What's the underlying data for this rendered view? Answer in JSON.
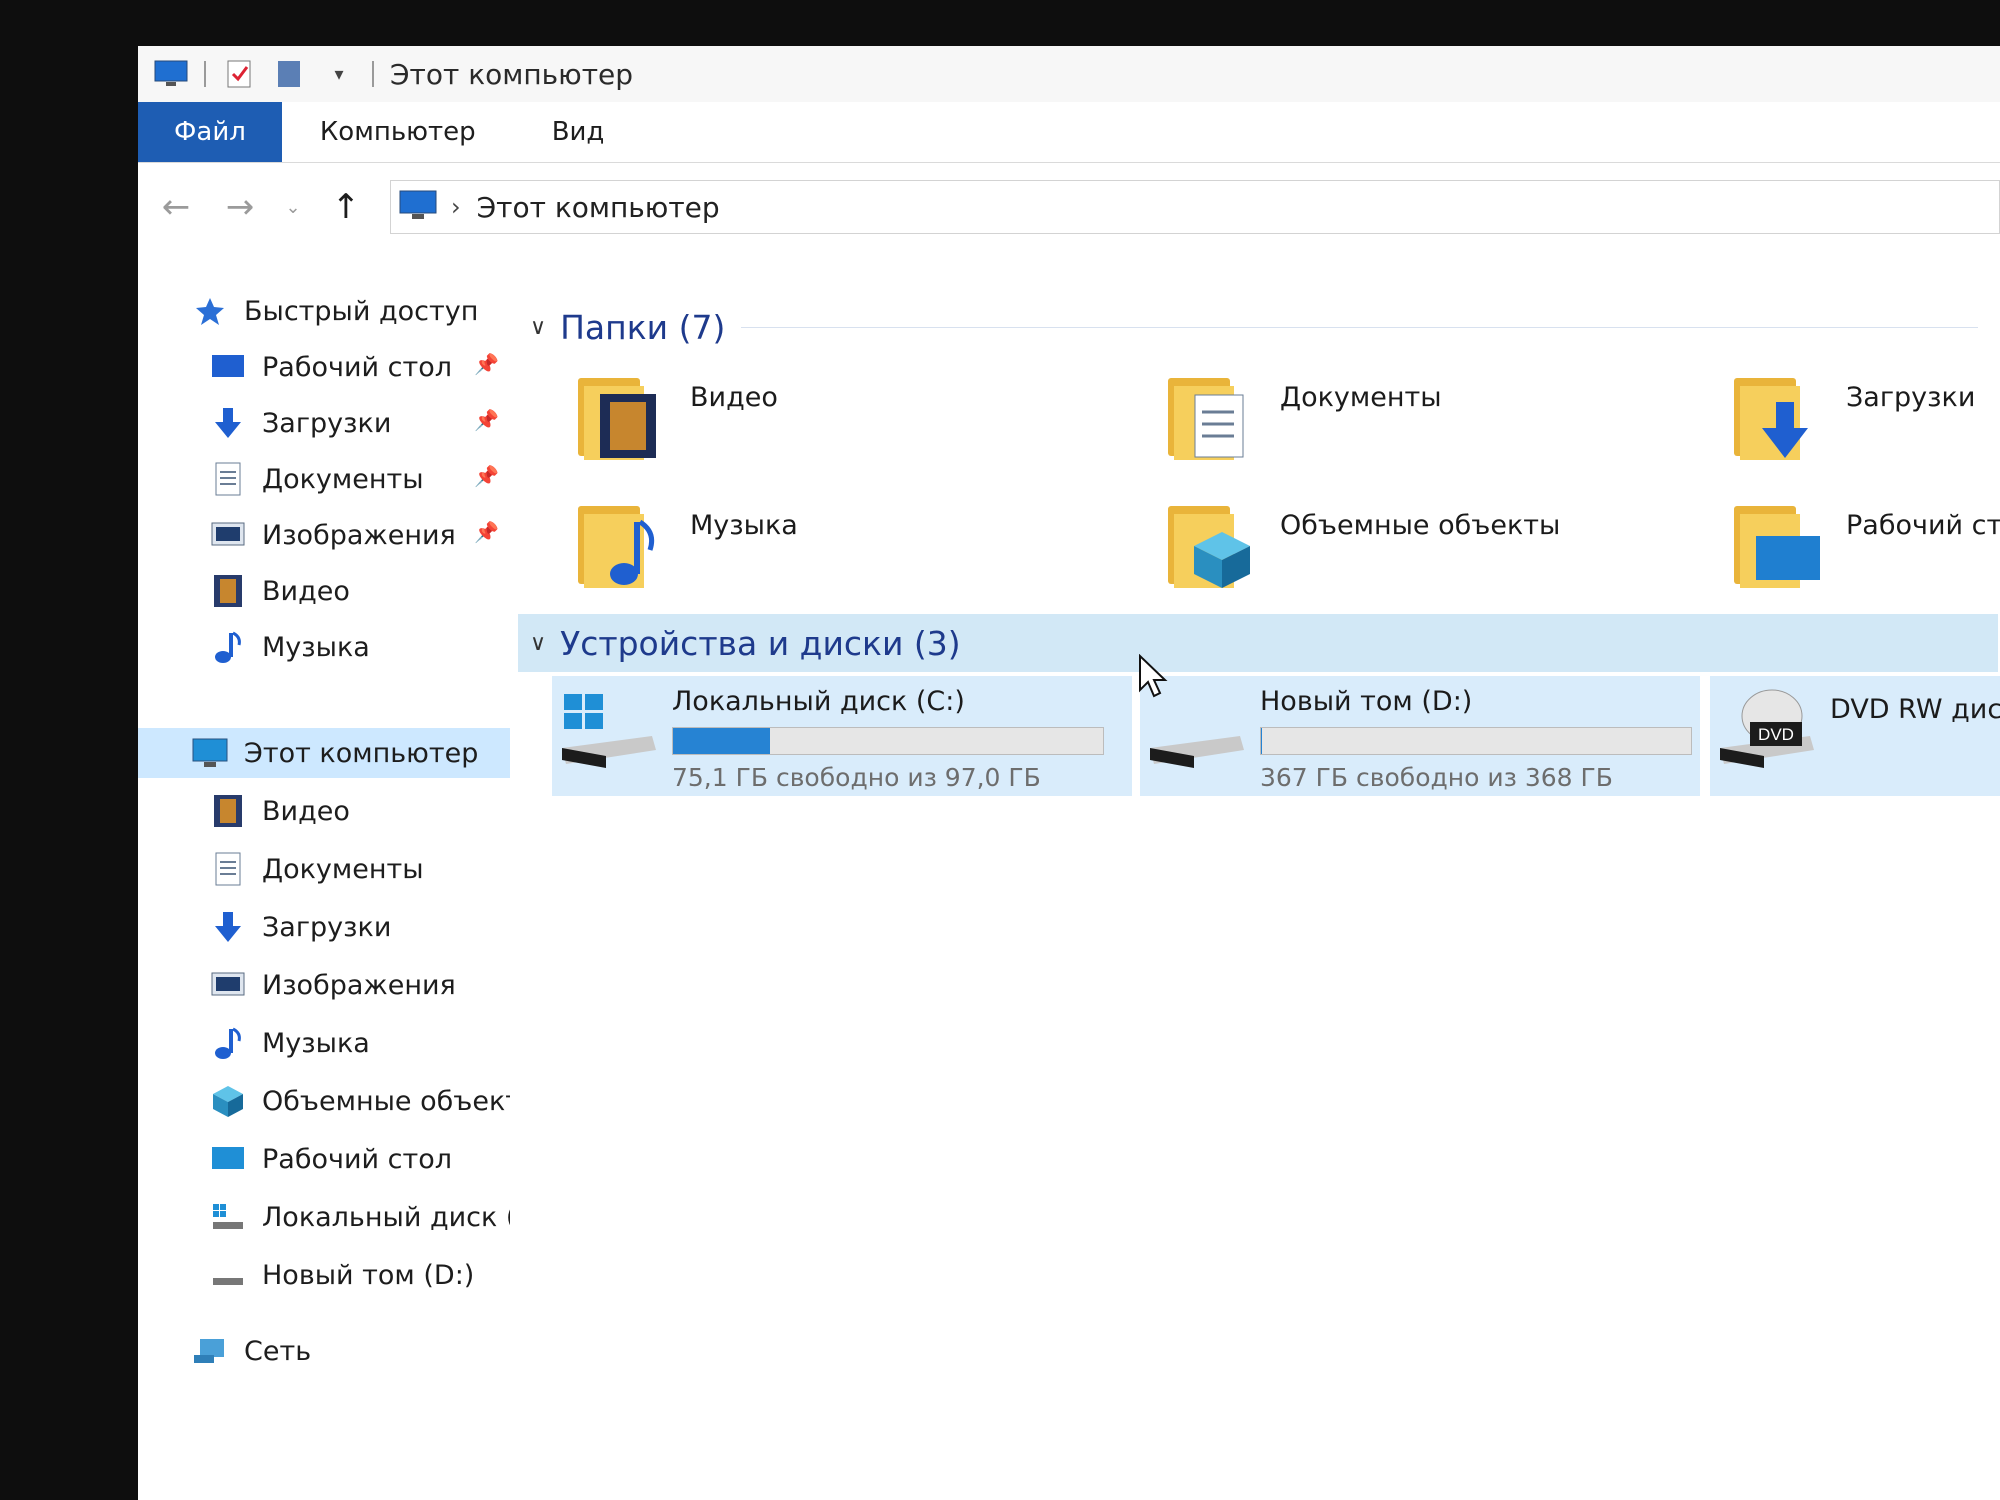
{
  "window": {
    "title": "Этот компьютер"
  },
  "ribbon": {
    "tabs": [
      "Файл",
      "Компьютер",
      "Вид"
    ]
  },
  "address": {
    "path": "Этот компьютер"
  },
  "nav": {
    "quick_access": "Быстрый доступ",
    "quick_items": [
      "Рабочий стол",
      "Загрузки",
      "Документы",
      "Изображения",
      "Видео",
      "Музыка"
    ],
    "this_pc": "Этот компьютер",
    "pc_items": [
      "Видео",
      "Документы",
      "Загрузки",
      "Изображения",
      "Музыка",
      "Объемные объекты",
      "Рабочий стол",
      "Локальный диск (C:)",
      "Новый том (D:)"
    ],
    "network": "Сеть"
  },
  "content": {
    "folders_header": "Папки (7)",
    "folders": [
      "Видео",
      "Документы",
      "Загрузки",
      "Музыка",
      "Объемные объекты",
      "Рабочий стол"
    ],
    "devices_header": "Устройства и диски (3)",
    "drives": [
      {
        "name": "Локальный диск (C:)",
        "free_text": "75,1 ГБ свободно из 97,0 ГБ",
        "used_fraction": 0.226
      },
      {
        "name": "Новый том (D:)",
        "free_text": "367 ГБ свободно из 368 ГБ",
        "used_fraction": 0.003
      },
      {
        "name": "DVD RW дисковод",
        "badge": "DVD"
      }
    ]
  },
  "colors": {
    "accent": "#1e5db3",
    "selection": "#cde8ff",
    "header_text": "#1e3a8c",
    "drive_bar": "#2683d3",
    "folder": "#f6cf5c"
  }
}
